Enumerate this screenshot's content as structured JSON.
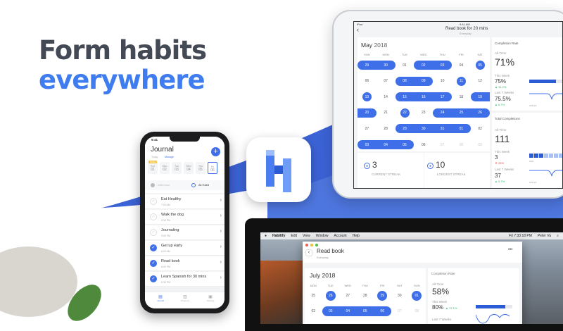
{
  "headline": {
    "line1": "Form habits",
    "line2": "everywhere"
  },
  "colors": {
    "accent": "#3f6fe8",
    "headline_dark": "#444a55",
    "headline_blue": "#3f7cf0",
    "positive": "#3bb56b",
    "negative": "#e44444"
  },
  "ipad": {
    "status_left": "iPad",
    "status_time": "9:41 AM",
    "title": "Read book for 20 mins",
    "subtitle": "Everyday",
    "calendar": {
      "month": "May",
      "year": "2018",
      "weekdays": [
        "SUN",
        "MON",
        "TUE",
        "WED",
        "THU",
        "FRI",
        "SAT"
      ],
      "days": [
        {
          "d": "29",
          "s": "start"
        },
        {
          "d": "30",
          "s": "end"
        },
        {
          "d": "01",
          "s": "none"
        },
        {
          "d": "02",
          "s": "start"
        },
        {
          "d": "03",
          "s": "end"
        },
        {
          "d": "04",
          "s": "none"
        },
        {
          "d": "05",
          "s": "single"
        },
        {
          "d": "06",
          "s": "none"
        },
        {
          "d": "07",
          "s": "none"
        },
        {
          "d": "08",
          "s": "start"
        },
        {
          "d": "09",
          "s": "end"
        },
        {
          "d": "10",
          "s": "none"
        },
        {
          "d": "11",
          "s": "single"
        },
        {
          "d": "12",
          "s": "none"
        },
        {
          "d": "13",
          "s": "single"
        },
        {
          "d": "14",
          "s": "none"
        },
        {
          "d": "15",
          "s": "start"
        },
        {
          "d": "16",
          "s": "mid"
        },
        {
          "d": "17",
          "s": "end"
        },
        {
          "d": "18",
          "s": "none"
        },
        {
          "d": "19",
          "s": "start"
        },
        {
          "d": "20",
          "s": "end"
        },
        {
          "d": "21",
          "s": "none"
        },
        {
          "d": "22",
          "s": "single"
        },
        {
          "d": "23",
          "s": "none"
        },
        {
          "d": "24",
          "s": "start"
        },
        {
          "d": "25",
          "s": "mid"
        },
        {
          "d": "26",
          "s": "end"
        },
        {
          "d": "27",
          "s": "none"
        },
        {
          "d": "28",
          "s": "none"
        },
        {
          "d": "29",
          "s": "start"
        },
        {
          "d": "30",
          "s": "mid"
        },
        {
          "d": "31",
          "s": "mid"
        },
        {
          "d": "01",
          "s": "end"
        },
        {
          "d": "02",
          "s": "none"
        },
        {
          "d": "03",
          "s": "start"
        },
        {
          "d": "04",
          "s": "mid"
        },
        {
          "d": "05",
          "s": "end"
        },
        {
          "d": "06",
          "s": "none"
        },
        {
          "d": "07",
          "s": "faded"
        },
        {
          "d": "08",
          "s": "faded"
        },
        {
          "d": "09",
          "s": "faded"
        }
      ]
    },
    "streaks": [
      {
        "value": "3",
        "label": "CURRENT STREAK"
      },
      {
        "value": "10",
        "label": "LONGEST STREAK"
      }
    ],
    "completion_rate": {
      "title": "Completion Rate",
      "all_time_label": "All-Time",
      "all_time": "71%",
      "week_label": "This Week",
      "week": "75%",
      "week_delta": "▲ 31.2%",
      "week_progress": 0.75,
      "last7_label": "Last 7 Weeks",
      "last7": "75.5%",
      "last7_delta": "▲ 6.7%",
      "axis_label": "APR 15"
    },
    "total_completions": {
      "title": "Total Completions",
      "all_time_label": "All-Time",
      "all_time": "111",
      "week_label": "This Week",
      "week": "3",
      "week_delta": "▼ 25%",
      "week_days_done": 3,
      "week_axis": "SUN",
      "last7_label": "Last 7 Weeks",
      "last7": "37",
      "last7_delta": "▲ 5.7%",
      "axis_label": "APR 15"
    }
  },
  "phone": {
    "time": "9:41",
    "title": "Journal",
    "tabs": [
      "Today",
      "Manage"
    ],
    "dates": [
      {
        "badge": "Today",
        "dow": "Sun",
        "num": "01"
      },
      {
        "dow": "Mon",
        "num": "02"
      },
      {
        "dow": "Tue",
        "num": "03"
      },
      {
        "dow": "Wed",
        "num": "04"
      },
      {
        "dow": "Thu",
        "num": "05"
      },
      {
        "dow": "Fri",
        "num": "06"
      }
    ],
    "filters": [
      "Afternoon",
      "All Habit"
    ],
    "habits": [
      {
        "name": "Eat Healthy",
        "time": "7:00 AM",
        "done": false
      },
      {
        "name": "Walk the dog",
        "time": "5:30 PM",
        "done": false
      },
      {
        "name": "Journaling",
        "time": "9:00 PM",
        "done": false
      },
      {
        "name": "Get up early",
        "time": "6:00 AM",
        "done": true
      },
      {
        "name": "Read book",
        "time": "8:00 PM",
        "done": true
      },
      {
        "name": "Learn Spanish for 30 mins",
        "time": "6:30 PM",
        "done": true
      }
    ],
    "tabbar": [
      "Journal",
      "Progress",
      "Settings"
    ]
  },
  "mac": {
    "menu": [
      "Habitify",
      "Edit",
      "View",
      "Window",
      "Account",
      "Help"
    ],
    "clock": "Fri 7:33:18 PM",
    "user": "Peter Vu",
    "title": "Read book",
    "subtitle": "Everyday",
    "more": "•••",
    "calendar": {
      "month": "July",
      "year": "2018",
      "weekdays": [
        "MON",
        "TUE",
        "WED",
        "THU",
        "FRI",
        "SAT",
        "SUN"
      ],
      "days": [
        {
          "d": "25",
          "s": "none"
        },
        {
          "d": "26",
          "s": "single"
        },
        {
          "d": "27",
          "s": "none"
        },
        {
          "d": "28",
          "s": "none"
        },
        {
          "d": "29",
          "s": "single"
        },
        {
          "d": "30",
          "s": "none"
        },
        {
          "d": "01",
          "s": "single"
        },
        {
          "d": "02",
          "s": "none"
        },
        {
          "d": "03",
          "s": "start"
        },
        {
          "d": "04",
          "s": "mid"
        },
        {
          "d": "05",
          "s": "mid"
        },
        {
          "d": "06",
          "s": "end"
        },
        {
          "d": "07",
          "s": "faded"
        },
        {
          "d": "08",
          "s": "faded"
        }
      ]
    },
    "completion_rate": {
      "title": "Completion Rate",
      "all_time_label": "All-Time",
      "all_time": "58%",
      "week_label": "This Week",
      "week": "80%",
      "week_delta": "▲ 37.1%",
      "week_progress": 0.8,
      "last7_label": "Last 7 Weeks"
    }
  }
}
